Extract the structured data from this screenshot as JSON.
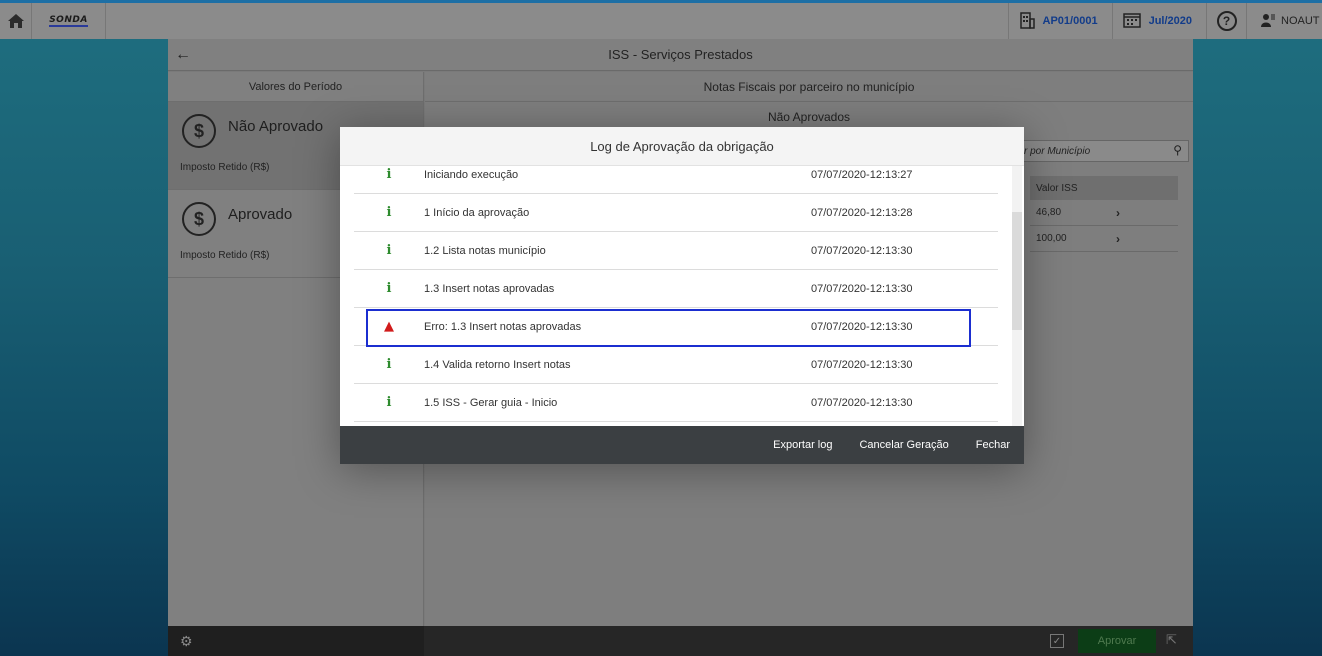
{
  "topbar": {
    "logo": "SONDA",
    "company": "AP01/0001",
    "period": "Jul/2020",
    "help": "?",
    "user": "NOAUT"
  },
  "page": {
    "title": "ISS - Serviços Prestados"
  },
  "left": {
    "header": "Valores do Período",
    "cards": [
      {
        "label": "Não Aprovado",
        "sub": "Imposto Retido (R$)"
      },
      {
        "label": "Aprovado",
        "sub": "Imposto Retido (R$)"
      }
    ]
  },
  "right": {
    "header": "Notas Fiscais por parceiro no município",
    "subheader": "Não Aprovados",
    "filter_placeholder": "r por Município",
    "table": {
      "column": "Valor ISS",
      "rows": [
        "46,80",
        "100,00"
      ]
    }
  },
  "footer": {
    "approve": "Aprovar"
  },
  "modal": {
    "title": "Log de Aprovação da obrigação",
    "rows": [
      {
        "type": "info",
        "icon": "i",
        "message": "Iniciando execução",
        "time": "07/07/2020-12:13:27"
      },
      {
        "type": "info",
        "icon": "i",
        "message": "1 Início da aprovação",
        "time": "07/07/2020-12:13:28"
      },
      {
        "type": "info",
        "icon": "i",
        "message": "1.2 Lista notas município",
        "time": "07/07/2020-12:13:30"
      },
      {
        "type": "info",
        "icon": "i",
        "message": "1.3 Insert notas aprovadas",
        "time": "07/07/2020-12:13:30"
      },
      {
        "type": "error",
        "icon": "▲",
        "message": "Erro: 1.3 Insert notas aprovadas",
        "time": "07/07/2020-12:13:30"
      },
      {
        "type": "info",
        "icon": "i",
        "message": "1.4 Valida retorno Insert notas",
        "time": "07/07/2020-12:13:30"
      },
      {
        "type": "info",
        "icon": "i",
        "message": "1.5 ISS - Gerar guia - Inicio",
        "time": "07/07/2020-12:13:30"
      }
    ],
    "buttons": {
      "export": "Exportar log",
      "cancel": "Cancelar Geração",
      "close": "Fechar"
    }
  }
}
